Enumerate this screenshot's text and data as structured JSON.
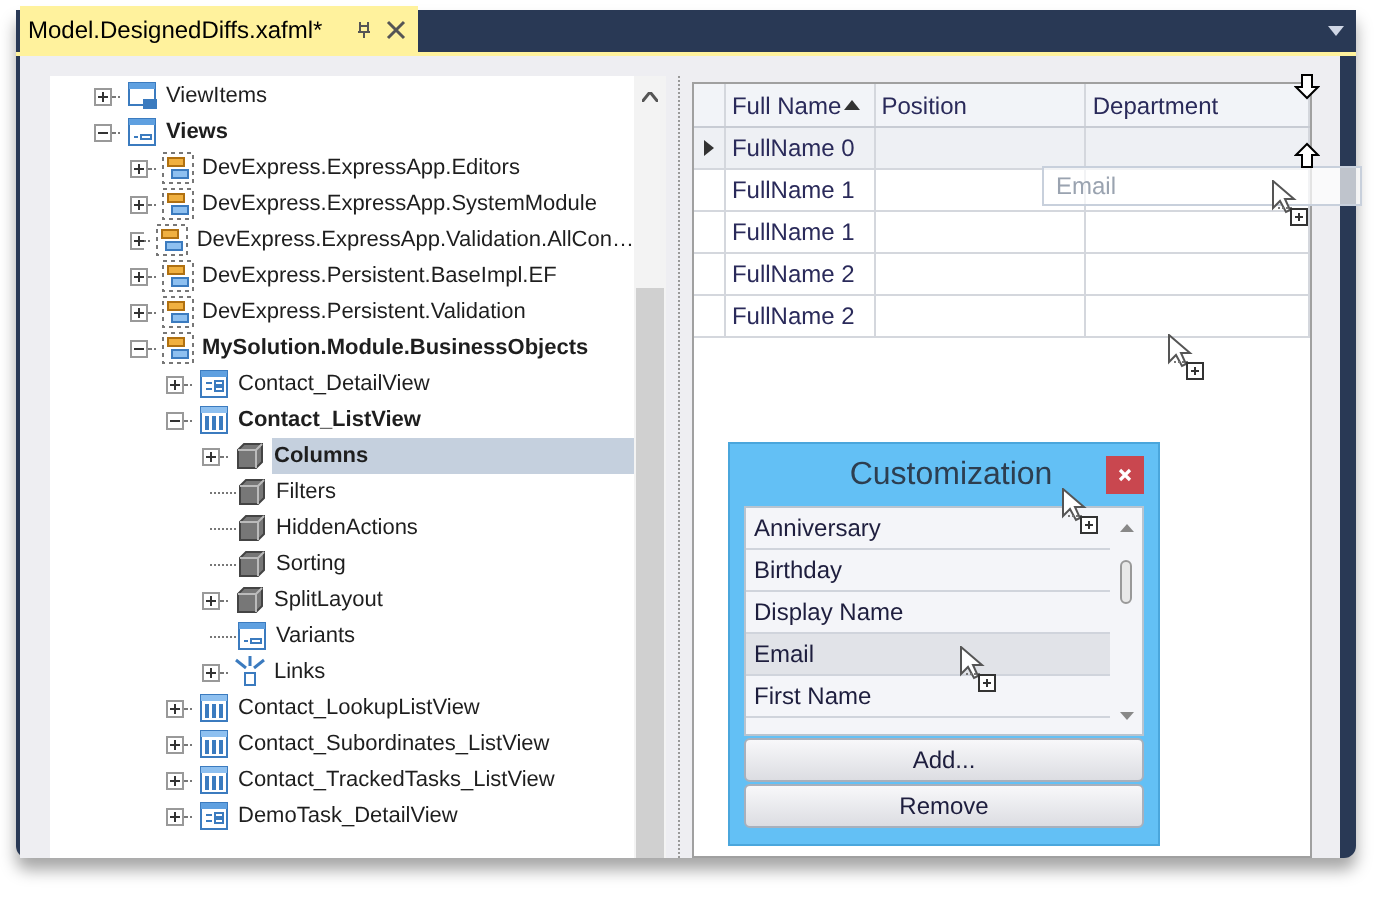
{
  "document_tab": {
    "title": "Model.DesignedDiffs.xafml*",
    "active": true
  },
  "tree": [
    {
      "label": "ViewItems",
      "kind": "view-items",
      "expanded": false,
      "bold": false,
      "selected": false
    },
    {
      "label": "Views",
      "kind": "views",
      "expanded": true,
      "bold": true,
      "selected": false,
      "children": [
        {
          "label": "DevExpress.ExpressApp.Editors",
          "kind": "module",
          "expanded": false,
          "bold": false,
          "selected": false
        },
        {
          "label": "DevExpress.ExpressApp.SystemModule",
          "kind": "module",
          "expanded": false,
          "bold": false,
          "selected": false
        },
        {
          "label": "DevExpress.ExpressApp.Validation.AllCon…",
          "kind": "module",
          "expanded": false,
          "bold": false,
          "selected": false
        },
        {
          "label": "DevExpress.Persistent.BaseImpl.EF",
          "kind": "module",
          "expanded": false,
          "bold": false,
          "selected": false
        },
        {
          "label": "DevExpress.Persistent.Validation",
          "kind": "module",
          "expanded": false,
          "bold": false,
          "selected": false
        },
        {
          "label": "MySolution.Module.BusinessObjects",
          "kind": "module",
          "expanded": true,
          "bold": true,
          "selected": false,
          "children": [
            {
              "label": "Contact_DetailView",
              "kind": "detail-view",
              "expanded": false,
              "bold": false,
              "selected": false
            },
            {
              "label": "Contact_ListView",
              "kind": "list-view",
              "expanded": true,
              "bold": true,
              "selected": false,
              "children": [
                {
                  "label": "Columns",
                  "kind": "node",
                  "expanded": false,
                  "bold": true,
                  "selected": true
                },
                {
                  "label": "Filters",
                  "kind": "node",
                  "bold": false,
                  "selected": false
                },
                {
                  "label": "HiddenActions",
                  "kind": "node",
                  "bold": false,
                  "selected": false
                },
                {
                  "label": "Sorting",
                  "kind": "node",
                  "bold": false,
                  "selected": false
                },
                {
                  "label": "SplitLayout",
                  "kind": "node",
                  "expanded": false,
                  "bold": false,
                  "selected": false
                },
                {
                  "label": "Variants",
                  "kind": "views",
                  "bold": false,
                  "selected": false
                },
                {
                  "label": "Links",
                  "kind": "links",
                  "expanded": false,
                  "bold": false,
                  "selected": false
                }
              ]
            },
            {
              "label": "Contact_LookupListView",
              "kind": "list-view",
              "expanded": false,
              "bold": false,
              "selected": false
            },
            {
              "label": "Contact_Subordinates_ListView",
              "kind": "list-view",
              "expanded": false,
              "bold": false,
              "selected": false
            },
            {
              "label": "Contact_TrackedTasks_ListView",
              "kind": "list-view",
              "expanded": false,
              "bold": false,
              "selected": false
            },
            {
              "label": "DemoTask_DetailView",
              "kind": "detail-view",
              "expanded": false,
              "bold": false,
              "selected": false
            }
          ]
        }
      ]
    }
  ],
  "grid": {
    "columns": [
      {
        "label": "Full Name",
        "sorted_ascending": true
      },
      {
        "label": "Position",
        "sorted_ascending": false
      },
      {
        "label": "Department",
        "sorted_ascending": false
      }
    ],
    "rows": [
      {
        "full_name": "FullName 0",
        "current": true
      },
      {
        "full_name": "FullName 1",
        "current": false
      },
      {
        "full_name": "FullName 1",
        "current": false
      },
      {
        "full_name": "FullName 2",
        "current": false
      },
      {
        "full_name": "FullName 2",
        "current": false
      }
    ]
  },
  "dragged_column": {
    "label": "Email"
  },
  "customization": {
    "title": "Customization",
    "items": [
      {
        "label": "Anniversary",
        "selected": false
      },
      {
        "label": "Birthday",
        "selected": false
      },
      {
        "label": "Display Name",
        "selected": false
      },
      {
        "label": "Email",
        "selected": true
      },
      {
        "label": "First Name",
        "selected": false
      }
    ],
    "buttons": [
      "Add...",
      "Remove"
    ]
  }
}
